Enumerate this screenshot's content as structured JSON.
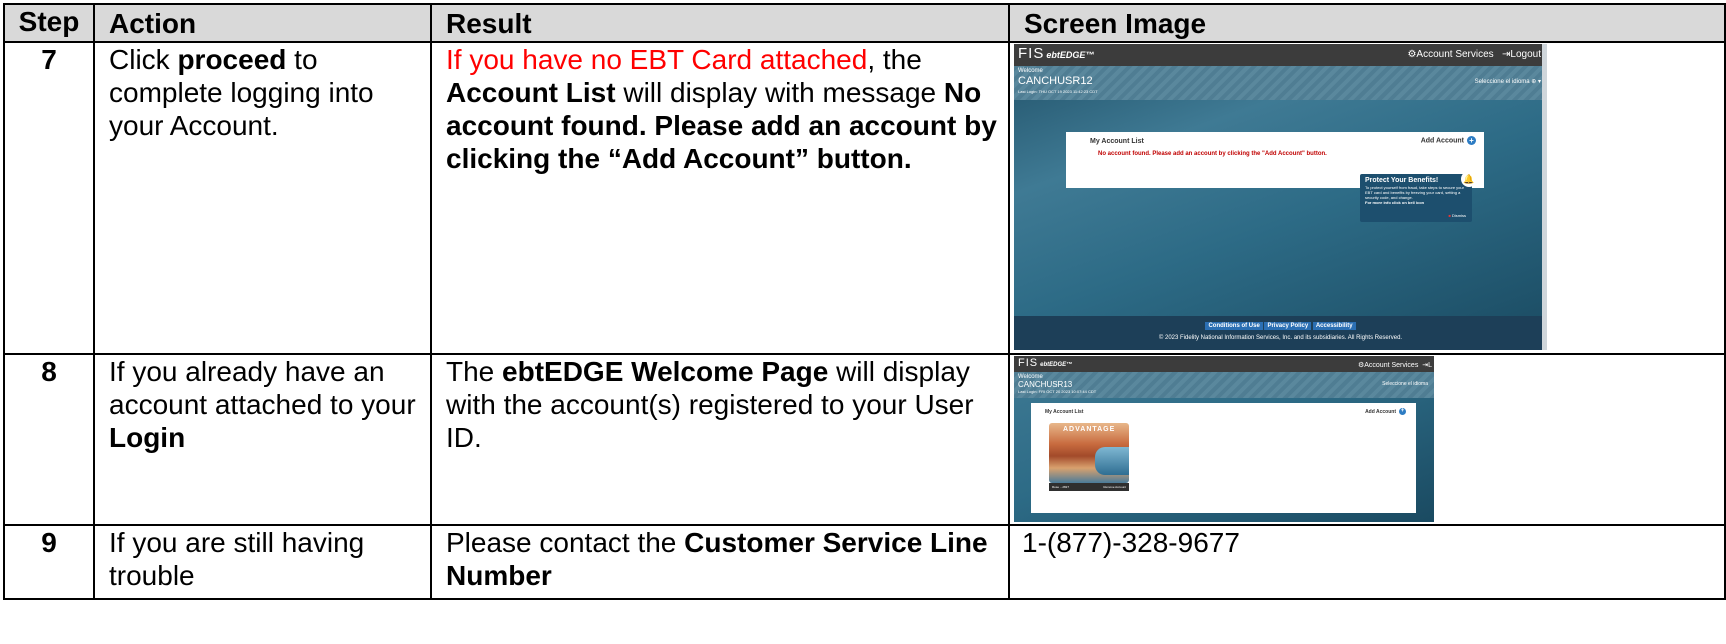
{
  "headers": [
    "Step",
    "Action",
    "Result",
    "Screen Image"
  ],
  "rows": [
    {
      "step": "7",
      "action": {
        "pre": "Click ",
        "bold": "proceed",
        "post": " to complete logging into your Account."
      },
      "result": {
        "red": "If you have no EBT Card attached",
        "after_red": ", the ",
        "bold1": "Account List",
        "mid": " will display with message ",
        "bold2": "No account found.  Please add an account by clicking the “Add Account” button."
      }
    },
    {
      "step": "8",
      "action": {
        "pre": "If you already have an account attached to your ",
        "bold": "Login"
      },
      "result": {
        "pre": "The ",
        "bold": "ebtEDGE Welcome Page",
        "post": " will display with the account(s) registered to your User ID."
      }
    },
    {
      "step": "9",
      "action": {
        "text": "If you are still having trouble"
      },
      "result": {
        "pre": "Please contact the ",
        "bold": "Customer Service Line Number"
      },
      "screen_text": "1-(877)-328-9677"
    }
  ],
  "screen1": {
    "logo": "FIS",
    "logo_sub": "ebtEDGE™",
    "nav_services": "Account Services",
    "nav_logout": "Logout",
    "welcome": "Welcome",
    "user": "CANCHUSR12",
    "last_login": "Last Login: THU OCT 19 2023 11:42:23 CDT",
    "language": "Seleccione el idioma",
    "panel_title": "My Account List",
    "add_account": "Add Account",
    "message": "No account found. Please add an account by clicking the \"Add Account\" button.",
    "protect_title": "Protect Your Benefits!",
    "protect_body": "To protect yourself from fraud, take steps to secure your EBT card and benefits by freezing your card, setting a security code, and change.",
    "protect_more": "For more info click on bell icon",
    "dismiss": "Dismiss",
    "footer_links": [
      "Conditions of Use",
      "Privacy Policy",
      "Accessibility"
    ],
    "copyright": "© 2023 Fidelity National Information Services, Inc. and its subsidiaries. All Rights Reserved."
  },
  "screen2": {
    "logo": "FIS",
    "logo_sub": "ebtEDGE™",
    "nav_services": "Account Services",
    "nav_logout": "L",
    "welcome": "Welcome",
    "user": "CANCHUSR13",
    "last_login": "Last Login: FRI OCT 20 2023 10:07:44 CDT",
    "language": "Seleccione el idioma",
    "panel_title": "My Account List",
    "add_account": "Add Account",
    "card_brand": "ADVANTAGE",
    "card_number": "Rose ...2827",
    "remove": "Remove Account"
  }
}
